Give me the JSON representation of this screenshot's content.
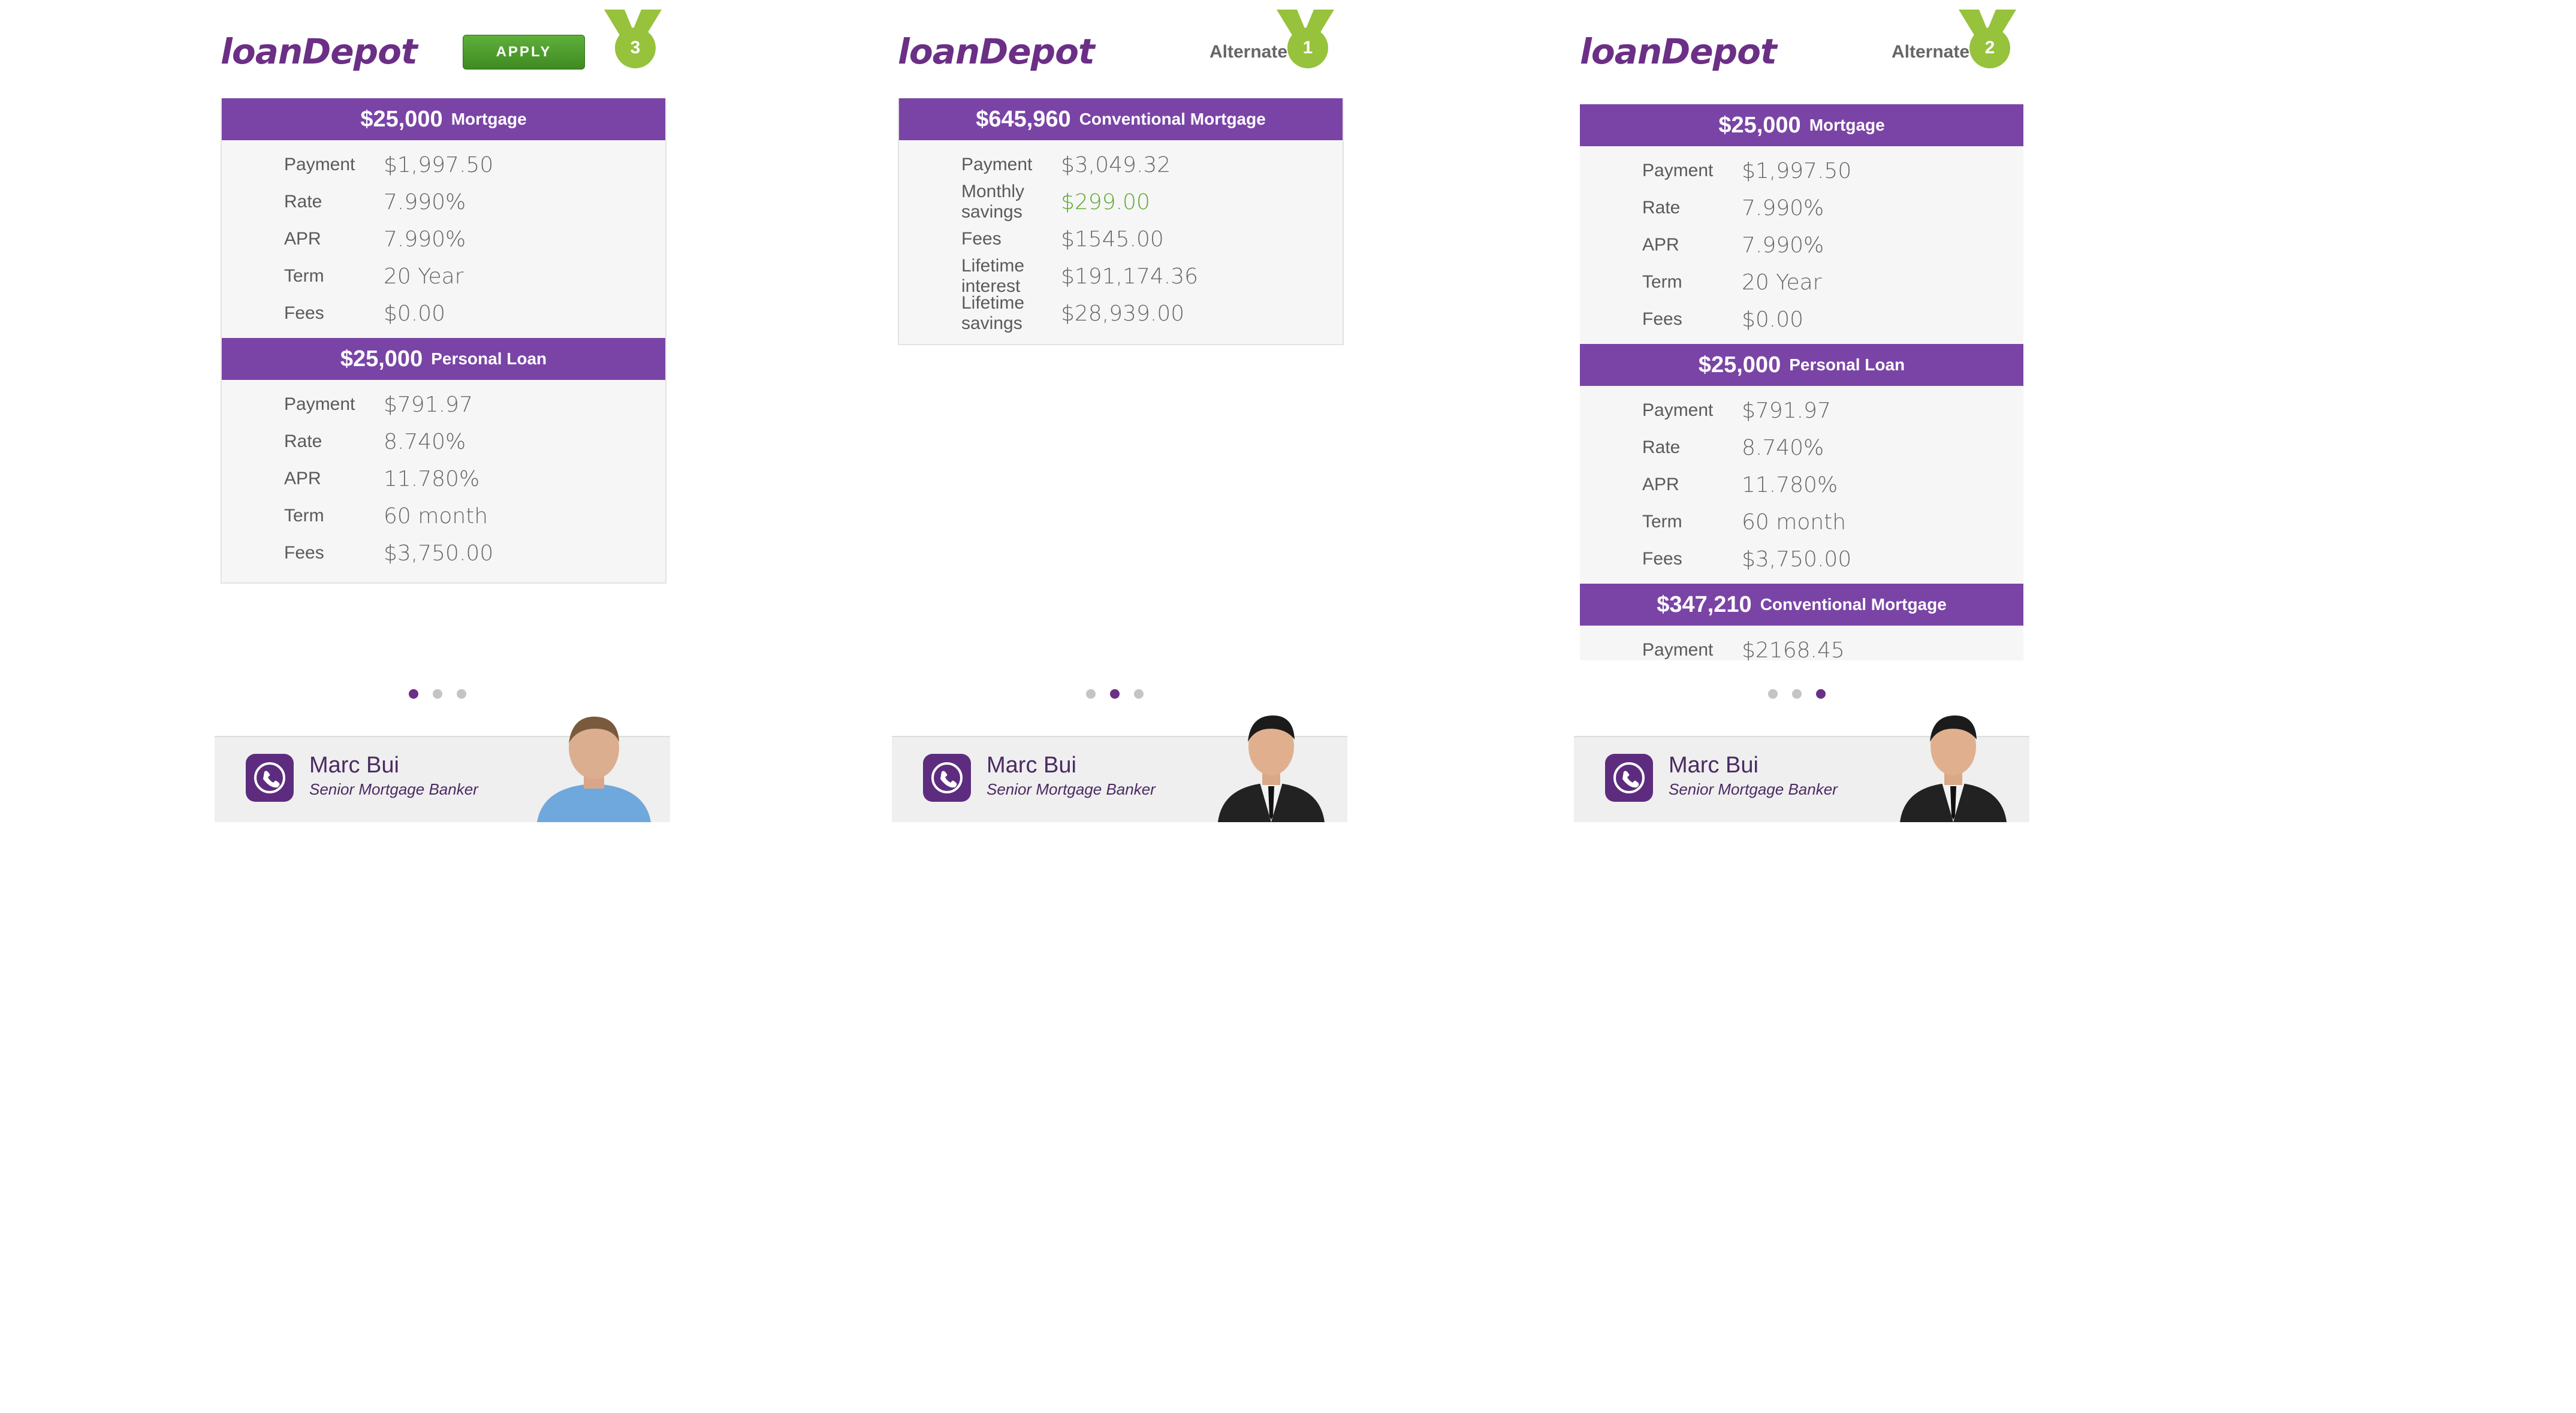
{
  "brand": {
    "logo_text": "loanDepot"
  },
  "panels": [
    {
      "apply_label": "APPLY",
      "badge_number": "3",
      "sections": [
        {
          "amount": "$25,000",
          "title": "Mortgage",
          "rows": [
            {
              "label": "Payment",
              "value": "$1,997.50"
            },
            {
              "label": "Rate",
              "value": "7.990%"
            },
            {
              "label": "APR",
              "value": "7.990%"
            },
            {
              "label": "Term",
              "value": "20 Year"
            },
            {
              "label": "Fees",
              "value": "$0.00"
            }
          ]
        },
        {
          "amount": "$25,000",
          "title": "Personal Loan",
          "rows": [
            {
              "label": "Payment",
              "value": "$791.97"
            },
            {
              "label": "Rate",
              "value": "8.740%"
            },
            {
              "label": "APR",
              "value": "11.780%"
            },
            {
              "label": "Term",
              "value": "60 month"
            },
            {
              "label": "Fees",
              "value": "$3,750.00"
            }
          ]
        }
      ],
      "banker": {
        "name": "Marc Bui",
        "title": "Senior Mortgage Banker"
      },
      "active_dot": 1
    },
    {
      "alt_label": "Alternate",
      "badge_number": "1",
      "sections": [
        {
          "amount": "$645,960",
          "title": "Conventional Mortgage",
          "rows": [
            {
              "label": "Payment",
              "value": "$3,049.32"
            },
            {
              "label": "Monthly savings",
              "value": "$299.00"
            },
            {
              "label": "Fees",
              "value": "$1545.00"
            },
            {
              "label": "Lifetime interest",
              "value": "$191,174.36"
            },
            {
              "label": "Lifetime savings",
              "value": "$28,939.00"
            }
          ]
        }
      ],
      "banker": {
        "name": "Marc Bui",
        "title": "Senior Mortgage Banker"
      },
      "active_dot": 2
    },
    {
      "alt_label": "Alternate",
      "badge_number": "2",
      "sections": [
        {
          "amount": "$25,000",
          "title": "Mortgage",
          "rows": [
            {
              "label": "Payment",
              "value": "$1,997.50"
            },
            {
              "label": "Rate",
              "value": "7.990%"
            },
            {
              "label": "APR",
              "value": "7.990%"
            },
            {
              "label": "Term",
              "value": "20 Year"
            },
            {
              "label": "Fees",
              "value": "$0.00"
            }
          ]
        },
        {
          "amount": "$25,000",
          "title": "Personal Loan",
          "rows": [
            {
              "label": "Payment",
              "value": "$791.97"
            },
            {
              "label": "Rate",
              "value": "8.740%"
            },
            {
              "label": "APR",
              "value": "11.780%"
            },
            {
              "label": "Term",
              "value": "60 month"
            },
            {
              "label": "Fees",
              "value": "$3,750.00"
            }
          ]
        },
        {
          "amount": "$347,210",
          "title": "Conventional Mortgage",
          "rows": [
            {
              "label": "Payment",
              "value": "$2168.45"
            }
          ]
        }
      ],
      "banker": {
        "name": "Marc Bui",
        "title": "Senior Mortgage Banker"
      },
      "active_dot": 3
    }
  ],
  "colors": {
    "purple": "#7a44a6",
    "green": "#96c23c",
    "savings_green": "#5aa82d"
  },
  "icons": {
    "phone": "phone-icon",
    "medal": "medal-icon"
  }
}
